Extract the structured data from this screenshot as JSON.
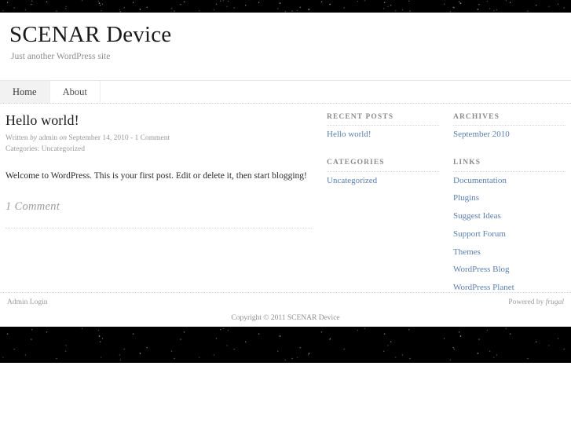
{
  "site": {
    "title": "SCENAR Device",
    "tagline": "Just another WordPress site"
  },
  "nav": {
    "items": [
      {
        "label": "Home",
        "active": true
      },
      {
        "label": "About",
        "active": false
      }
    ]
  },
  "post": {
    "title": "Hello world!",
    "meta_written": "Written ",
    "meta_by": "by",
    "meta_author": " admin ",
    "meta_on": "on",
    "meta_date": " September 14, 2010 - 1 Comment",
    "meta_categories": "Categories: Uncategorized",
    "body": "Welcome to WordPress. This is your first post. Edit or delete it, then start blogging!",
    "comments_heading": "1 Comment"
  },
  "sidebar_left": {
    "widgets": [
      {
        "title": "Recent Posts",
        "items": [
          "Hello world!"
        ]
      },
      {
        "title": "Categories",
        "items": [
          "Uncategorized"
        ]
      }
    ]
  },
  "sidebar_right": {
    "widgets": [
      {
        "title": "Archives",
        "items": [
          "September 2010"
        ]
      },
      {
        "title": "Links",
        "items": [
          "Documentation",
          "Plugins",
          "Suggest Ideas",
          "Support Forum",
          "Themes",
          "WordPress Blog",
          "WordPress Planet"
        ]
      }
    ]
  },
  "footer": {
    "admin_login": "Admin Login",
    "powered_by_prefix": "Powered by ",
    "powered_by_theme": "frugal",
    "copyright": "Copyright © 2011 SCENAR Device"
  },
  "colors": {
    "link": "#5b7fb0",
    "text": "#2b2b2b",
    "muted": "#9a9a9a",
    "banner": "#000000",
    "nav_active_bg": "#f2f2f2"
  }
}
